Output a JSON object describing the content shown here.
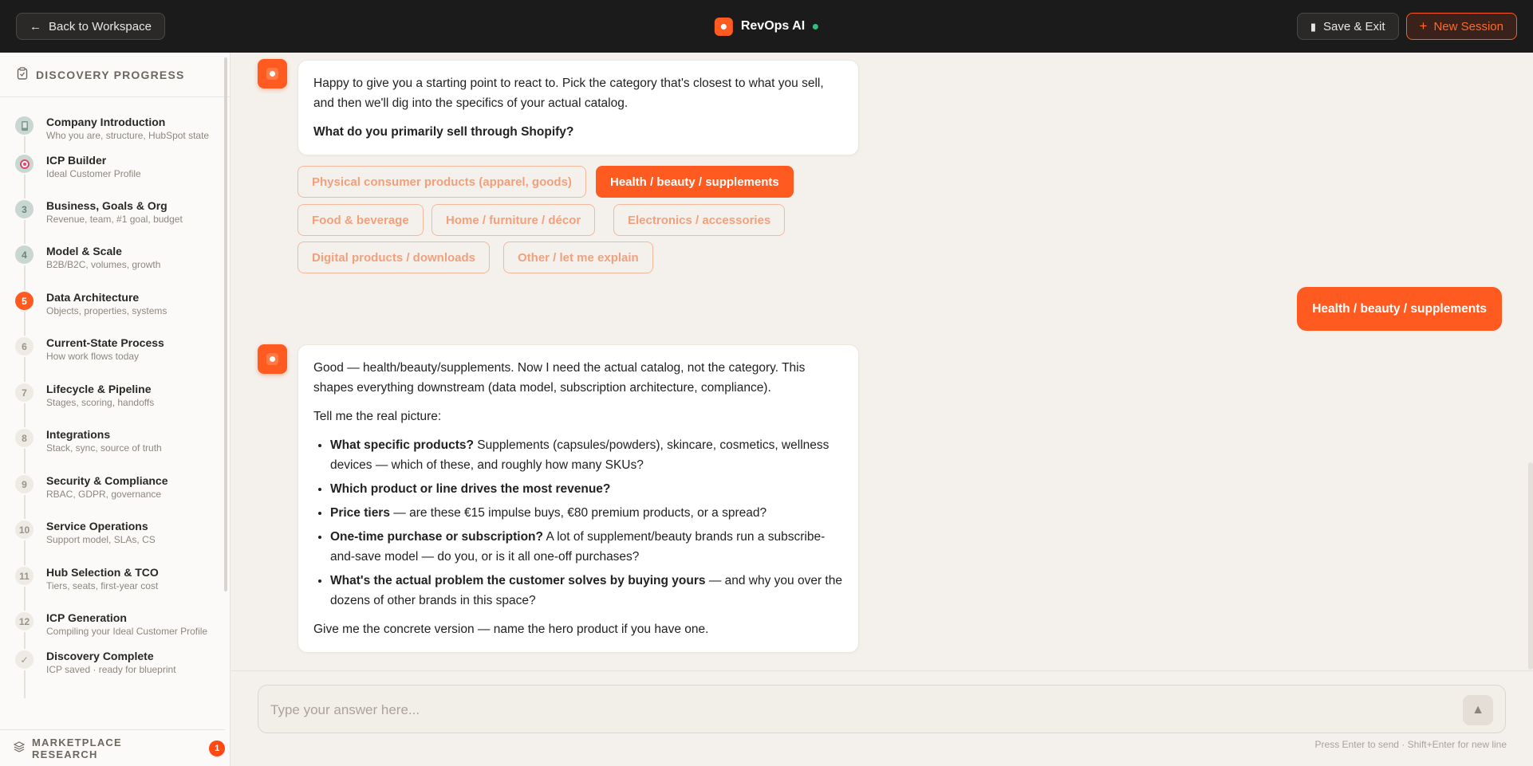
{
  "topbar": {
    "back_label": "Back to Workspace",
    "app_title": "RevOps AI",
    "save_exit_label": "Save & Exit",
    "new_session_label": "New Session"
  },
  "sidebar": {
    "heading": "DISCOVERY PROGRESS",
    "steps": [
      {
        "num": "",
        "title": "Company Introduction",
        "sub": "Who you are, structure, HubSpot state",
        "state": "done",
        "icon": "phone-icon"
      },
      {
        "num": "",
        "title": "ICP Builder",
        "sub": "Ideal Customer Profile",
        "state": "done",
        "icon": "target-icon"
      },
      {
        "num": "3",
        "title": "Business, Goals & Org",
        "sub": "Revenue, team, #1 goal, budget",
        "state": "done"
      },
      {
        "num": "4",
        "title": "Model & Scale",
        "sub": "B2B/B2C, volumes, growth",
        "state": "done"
      },
      {
        "num": "5",
        "title": "Data Architecture",
        "sub": "Objects, properties, systems",
        "state": "active"
      },
      {
        "num": "6",
        "title": "Current-State Process",
        "sub": "How work flows today",
        "state": "todo"
      },
      {
        "num": "7",
        "title": "Lifecycle & Pipeline",
        "sub": "Stages, scoring, handoffs",
        "state": "todo"
      },
      {
        "num": "8",
        "title": "Integrations",
        "sub": "Stack, sync, source of truth",
        "state": "todo"
      },
      {
        "num": "9",
        "title": "Security & Compliance",
        "sub": "RBAC, GDPR, governance",
        "state": "todo"
      },
      {
        "num": "10",
        "title": "Service Operations",
        "sub": "Support model, SLAs, CS",
        "state": "todo"
      },
      {
        "num": "11",
        "title": "Hub Selection & TCO",
        "sub": "Tiers, seats, first-year cost",
        "state": "todo"
      },
      {
        "num": "12",
        "title": "ICP Generation",
        "sub": "Compiling your Ideal Customer Profile",
        "state": "todo"
      },
      {
        "num": "✓",
        "title": "Discovery Complete",
        "sub": "ICP saved · ready for blueprint",
        "state": "todo"
      }
    ],
    "footer_label": "MARKETPLACE RESEARCH",
    "footer_badge": "1"
  },
  "chat": {
    "msg1": {
      "line1": "Happy to give you a starting point to react to. Pick the category that's closest to what you sell, and then we'll dig into the specifics of your actual catalog.",
      "question": "What do you primarily sell through Shopify?"
    },
    "chips": [
      "Physical consumer products (apparel, goods)",
      "Health / beauty / supplements",
      "Food & beverage",
      "Home / furniture / décor",
      "Electronics / accessories",
      "Digital products / downloads",
      "Other / let me explain"
    ],
    "user_reply": "Health / beauty / supplements",
    "msg2": {
      "intro": "Good — health/beauty/supplements. Now I need the actual catalog, not the category. This shapes everything downstream (data model, subscription architecture, compliance).",
      "lead": "Tell me the real picture:",
      "bullets": [
        {
          "bold": "What specific products?",
          "rest": " Supplements (capsules/powders), skincare, cosmetics, wellness devices — which of these, and roughly how many SKUs?"
        },
        {
          "bold": "Which product or line drives the most revenue?",
          "rest": ""
        },
        {
          "bold": "Price tiers",
          "rest": " — are these €15 impulse buys, €80 premium products, or a spread?"
        },
        {
          "bold": "One-time purchase or subscription?",
          "rest": " A lot of supplement/beauty brands run a subscribe-and-save model — do you, or is it all one-off purchases?"
        },
        {
          "bold": "What's the actual problem the customer solves by buying yours",
          "rest": " — and why you over the dozens of other brands in this space?"
        }
      ],
      "closing": "Give me the concrete version — name the hero product if you have one."
    }
  },
  "composer": {
    "placeholder": "Type your answer here...",
    "hint": "Press Enter to send · Shift+Enter for new line"
  }
}
